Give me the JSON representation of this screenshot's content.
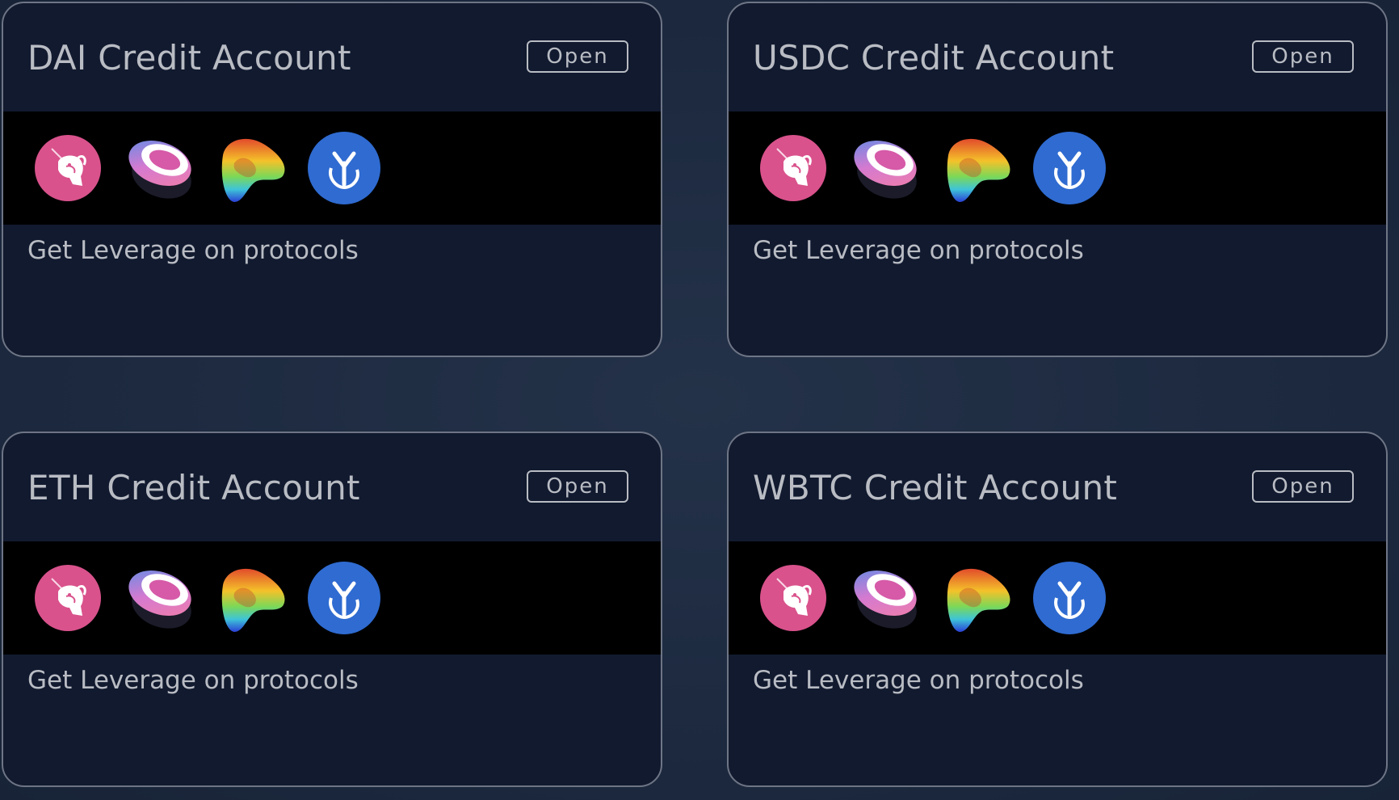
{
  "cards": [
    {
      "title": "DAI Credit Account",
      "button": "Open",
      "description": "Get Leverage on protocols"
    },
    {
      "title": "USDC Credit Account",
      "button": "Open",
      "description": "Get Leverage on protocols"
    },
    {
      "title": "ETH Credit Account",
      "button": "Open",
      "description": "Get Leverage on protocols"
    },
    {
      "title": "WBTC Credit Account",
      "button": "Open",
      "description": "Get Leverage on protocols"
    }
  ],
  "protocol_icons": [
    "uniswap-icon",
    "sushiswap-icon",
    "curve-icon",
    "yearn-icon"
  ],
  "colors": {
    "background": "#1d2a40",
    "card": "#111a2f",
    "icon_strip": "#000000",
    "text": "#b9bcc3",
    "uniswap": "#d9528c",
    "yearn": "#2f6bd1"
  }
}
